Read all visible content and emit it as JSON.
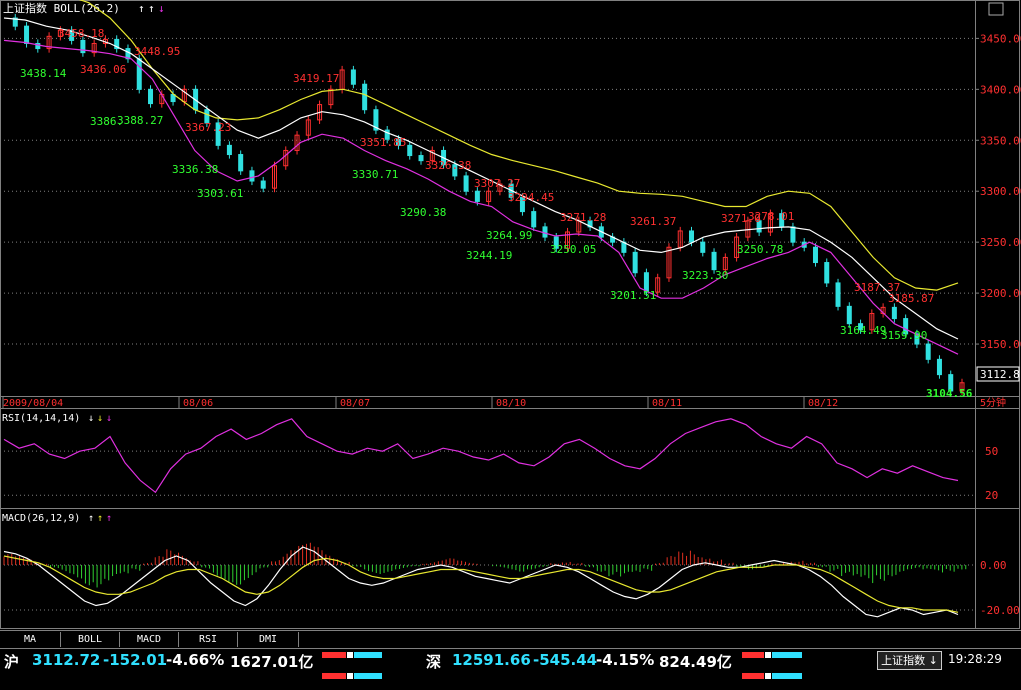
{
  "colors": {
    "price_label_high": "#ff3030",
    "price_label_low": "#30ff30",
    "boll_upper": "#e8e830",
    "boll_mid": "#ffffff",
    "boll_lower": "#e030e0",
    "rsi_line": "#e030e0",
    "macd_pos": "#e03020",
    "macd_neg": "#30d030",
    "dif_line": "#ffffff",
    "dea_line": "#e8e830",
    "axis_text": "#ff3030",
    "grid": "#808080"
  },
  "main_panel": {
    "indicator_name": "上证指数",
    "indicator_label": "BOLL(26,2)",
    "arrows": [
      "↑",
      "↑",
      "↓"
    ],
    "y_ticks": [
      "3450.00",
      "3400.00",
      "3350.00",
      "3300.00",
      "3250.00",
      "3200.00",
      "3150.00"
    ],
    "last_price_tag": "3112.8",
    "period_tag": "5分钟",
    "date_labels": [
      "2009/08/04",
      "08/06",
      "08/07",
      "08/10",
      "08/11",
      "08/12"
    ],
    "price_labels": [
      {
        "text": "3458.18",
        "kind": "high"
      },
      {
        "text": "3438.14",
        "kind": "low"
      },
      {
        "text": "3436.06",
        "kind": "high"
      },
      {
        "text": "3448.95",
        "kind": "high"
      },
      {
        "text": "3386.",
        "kind": "low"
      },
      {
        "text": "3388.27",
        "kind": "low"
      },
      {
        "text": "3367.23",
        "kind": "high"
      },
      {
        "text": "3336.38",
        "kind": "low"
      },
      {
        "text": "3303.61",
        "kind": "low"
      },
      {
        "text": "3419.17",
        "kind": "high"
      },
      {
        "text": "3351.85",
        "kind": "high"
      },
      {
        "text": "3330.71",
        "kind": "low"
      },
      {
        "text": "3326.38",
        "kind": "high"
      },
      {
        "text": "3290.38",
        "kind": "low"
      },
      {
        "text": "3307.27",
        "kind": "high"
      },
      {
        "text": "3294.45",
        "kind": "high"
      },
      {
        "text": "3264.99",
        "kind": "low"
      },
      {
        "text": "3244.19",
        "kind": "low"
      },
      {
        "text": "3271.28",
        "kind": "high"
      },
      {
        "text": "3250.05",
        "kind": "low"
      },
      {
        "text": "3261.37",
        "kind": "high"
      },
      {
        "text": "3201.51",
        "kind": "low"
      },
      {
        "text": "3223.30",
        "kind": "low"
      },
      {
        "text": "3271.0",
        "kind": "high"
      },
      {
        "text": "3278.01",
        "kind": "high"
      },
      {
        "text": "3250.78",
        "kind": "low"
      },
      {
        "text": "3187.37",
        "kind": "high"
      },
      {
        "text": "3185.87",
        "kind": "high"
      },
      {
        "text": "3164.49",
        "kind": "low"
      },
      {
        "text": "3159.90",
        "kind": "low"
      },
      {
        "text": "3104.56",
        "kind": "low"
      }
    ]
  },
  "rsi_panel": {
    "label": "RSI(14,14,14)",
    "arrows": [
      "↓",
      "↓",
      "↓"
    ],
    "y_ticks": [
      "50",
      "20"
    ]
  },
  "macd_panel": {
    "label": "MACD(26,12,9)",
    "arrows": [
      "↑",
      "↑",
      "↑"
    ],
    "y_ticks": [
      "0.00",
      "-20.00"
    ]
  },
  "tabs": [
    "MA",
    "BOLL",
    "MACD",
    "RSI",
    "DMI"
  ],
  "status": {
    "sh_name": "沪",
    "sh_price": "3112.72",
    "sh_change": "-152.01",
    "sh_pct": "-4.66%",
    "sh_amount": "1627.01亿",
    "sz_name": "深",
    "sz_price": "12591.66",
    "sz_change": "-545.44",
    "sz_pct": "-4.15%",
    "sz_amount": "824.49亿",
    "index_button": "上证指数",
    "index_arrow": "↓",
    "clock": "19:28:29"
  },
  "chart_data": {
    "type": "line",
    "title": "上证指数",
    "interval": "5分钟",
    "date_ticks": [
      "2009/08/04",
      "08/06",
      "08/07",
      "08/10",
      "08/11",
      "08/12"
    ],
    "ylim": [
      3100,
      3470
    ],
    "last_price": 3112.8,
    "close_path": [
      3470,
      3462,
      3445,
      3440,
      3452,
      3458,
      3448,
      3436,
      3445,
      3449,
      3440,
      3430,
      3400,
      3386,
      3395,
      3388,
      3400,
      3380,
      3367,
      3345,
      3336,
      3320,
      3310,
      3303,
      3325,
      3340,
      3355,
      3370,
      3385,
      3400,
      3419,
      3405,
      3380,
      3360,
      3351,
      3345,
      3335,
      3330,
      3340,
      3326,
      3315,
      3300,
      3290,
      3300,
      3307,
      3294,
      3280,
      3265,
      3255,
      3244,
      3260,
      3271,
      3265,
      3255,
      3250,
      3240,
      3220,
      3201,
      3215,
      3245,
      3261,
      3250,
      3240,
      3223,
      3235,
      3255,
      3271,
      3260,
      3278,
      3265,
      3250,
      3245,
      3230,
      3210,
      3187,
      3170,
      3164,
      3180,
      3186,
      3175,
      3160,
      3150,
      3135,
      3120,
      3104,
      3112
    ],
    "boll_upper": [
      3490,
      3492,
      3493,
      3492,
      3485,
      3470,
      3448,
      3420,
      3395,
      3380,
      3372,
      3370,
      3372,
      3380,
      3390,
      3398,
      3400,
      3395,
      3385,
      3375,
      3365,
      3355,
      3345,
      3336,
      3330,
      3325,
      3320,
      3314,
      3308,
      3300,
      3298,
      3297,
      3295,
      3290,
      3285,
      3285,
      3295,
      3300,
      3298,
      3285,
      3260,
      3235,
      3215,
      3205,
      3203,
      3210
    ],
    "boll_mid": [
      3470,
      3468,
      3462,
      3458,
      3452,
      3445,
      3435,
      3420,
      3405,
      3390,
      3375,
      3360,
      3352,
      3360,
      3372,
      3378,
      3375,
      3368,
      3358,
      3350,
      3340,
      3330,
      3320,
      3310,
      3300,
      3290,
      3280,
      3272,
      3262,
      3252,
      3242,
      3240,
      3245,
      3255,
      3260,
      3262,
      3264,
      3265,
      3262,
      3250,
      3235,
      3215,
      3195,
      3180,
      3165,
      3155
    ],
    "boll_lower": [
      3448,
      3446,
      3442,
      3440,
      3438,
      3435,
      3430,
      3410,
      3375,
      3340,
      3320,
      3310,
      3315,
      3330,
      3348,
      3356,
      3352,
      3340,
      3330,
      3322,
      3312,
      3300,
      3290,
      3285,
      3270,
      3262,
      3256,
      3258,
      3256,
      3240,
      3205,
      3195,
      3195,
      3205,
      3218,
      3226,
      3234,
      3240,
      3250,
      3240,
      3215,
      3190,
      3170,
      3160,
      3150,
      3140
    ],
    "rsi": [
      58,
      52,
      55,
      48,
      45,
      50,
      52,
      60,
      42,
      30,
      22,
      38,
      48,
      52,
      60,
      65,
      58,
      62,
      68,
      72,
      60,
      55,
      50,
      48,
      52,
      50,
      55,
      45,
      48,
      52,
      50,
      46,
      44,
      48,
      42,
      40,
      46,
      55,
      58,
      52,
      45,
      40,
      38,
      45,
      55,
      62,
      66,
      70,
      72,
      68,
      60,
      55,
      52,
      60,
      55,
      42,
      38,
      32,
      38,
      35,
      40,
      36,
      32,
      30
    ],
    "rsi_y_ticks": [
      50,
      20
    ],
    "macd_y_ticks": [
      0,
      -20
    ],
    "macd_hist": [
      5,
      4,
      3,
      1,
      -2,
      -4,
      -6,
      -9,
      -10,
      -8,
      -6,
      -3,
      1,
      4,
      7,
      6,
      3,
      -2,
      -6,
      -8,
      -9,
      -6,
      -2,
      3,
      7,
      9,
      10,
      8,
      5,
      2,
      -1,
      -3,
      -4,
      -3,
      -2,
      -1,
      1,
      2,
      3,
      2,
      1,
      0,
      -1,
      -2,
      -3,
      -2,
      -1,
      1,
      2,
      1,
      -1,
      -3,
      -5,
      -6,
      -5,
      -3,
      1,
      4,
      6,
      7,
      5,
      3,
      1,
      -1,
      -2,
      -1,
      1,
      2,
      2,
      1,
      -1,
      -3,
      -6,
      -8,
      -9,
      -7,
      -5,
      -3,
      -2,
      -3,
      -4,
      -3,
      -2
    ],
    "dif": [
      6,
      5,
      3,
      0,
      -4,
      -8,
      -12,
      -16,
      -18,
      -17,
      -14,
      -10,
      -6,
      -2,
      2,
      4,
      2,
      -3,
      -8,
      -12,
      -16,
      -18,
      -15,
      -9,
      -2,
      4,
      8,
      6,
      2,
      -2,
      -6,
      -8,
      -9,
      -8,
      -6,
      -4,
      -2,
      -1,
      0,
      -1,
      -3,
      -5,
      -6,
      -7,
      -8,
      -6,
      -4,
      -2,
      0,
      -1,
      -3,
      -6,
      -9,
      -12,
      -14,
      -15,
      -13,
      -10,
      -6,
      -2,
      0,
      1,
      0,
      -1,
      -1,
      0,
      1,
      2,
      1,
      0,
      -2,
      -5,
      -9,
      -14,
      -18,
      -22,
      -23,
      -21,
      -19,
      -20,
      -22,
      -21,
      -20,
      -22
    ],
    "dea": [
      4,
      3,
      2,
      1,
      -1,
      -4,
      -7,
      -10,
      -12,
      -13,
      -13,
      -12,
      -10,
      -8,
      -5,
      -3,
      -2,
      -2,
      -4,
      -6,
      -9,
      -12,
      -13,
      -12,
      -9,
      -5,
      -1,
      2,
      3,
      2,
      0,
      -3,
      -5,
      -6,
      -6,
      -5,
      -4,
      -3,
      -2,
      -2,
      -2,
      -3,
      -4,
      -5,
      -6,
      -6,
      -5,
      -4,
      -3,
      -2,
      -2,
      -3,
      -5,
      -7,
      -9,
      -11,
      -12,
      -12,
      -11,
      -9,
      -7,
      -5,
      -3,
      -2,
      -1,
      -1,
      -1,
      0,
      0,
      0,
      -1,
      -2,
      -4,
      -7,
      -10,
      -13,
      -16,
      -18,
      -19,
      -19,
      -20,
      -20,
      -20,
      -21
    ]
  }
}
